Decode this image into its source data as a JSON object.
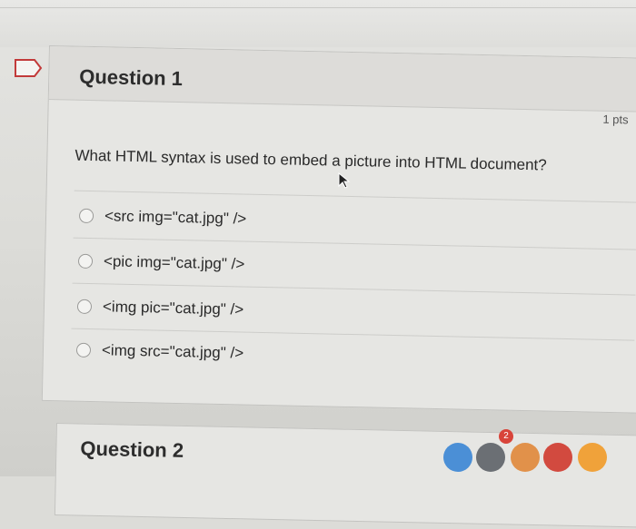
{
  "question": {
    "title": "Question 1",
    "points": "1 pts",
    "text": "What HTML syntax is used to embed a picture into HTML document?",
    "answers": [
      "<src img=\"cat.jpg\" />",
      "<pic img=\"cat.jpg\" />",
      "<img pic=\"cat.jpg\" />",
      "<img src=\"cat.jpg\" />"
    ]
  },
  "next_question": {
    "title": "Question 2"
  },
  "dock": {
    "badge_count": "2"
  },
  "colors": {
    "badge": "#d8443a",
    "card": "#e6e6e3",
    "flag": "#c23a3a"
  },
  "icons": [
    "flag-icon",
    "radio-icon",
    "mouse-cursor-icon"
  ]
}
